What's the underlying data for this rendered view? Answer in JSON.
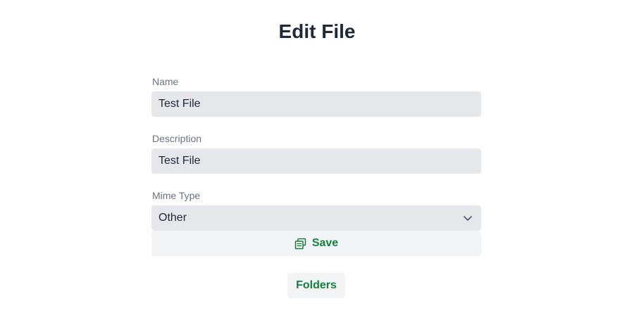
{
  "page": {
    "title": "Edit File"
  },
  "form": {
    "name": {
      "label": "Name",
      "value": "Test File"
    },
    "description": {
      "label": "Description",
      "value": "Test File"
    },
    "mime_type": {
      "label": "Mime Type",
      "selected": "Other"
    }
  },
  "actions": {
    "save_label": "Save",
    "save_icon": "copy-icon",
    "folders_label": "Folders"
  },
  "colors": {
    "accent": "#15803d",
    "input_bg": "#e5e7eb",
    "button_bg": "#f3f4f6",
    "label": "#6b7280",
    "text": "#1f2937"
  }
}
